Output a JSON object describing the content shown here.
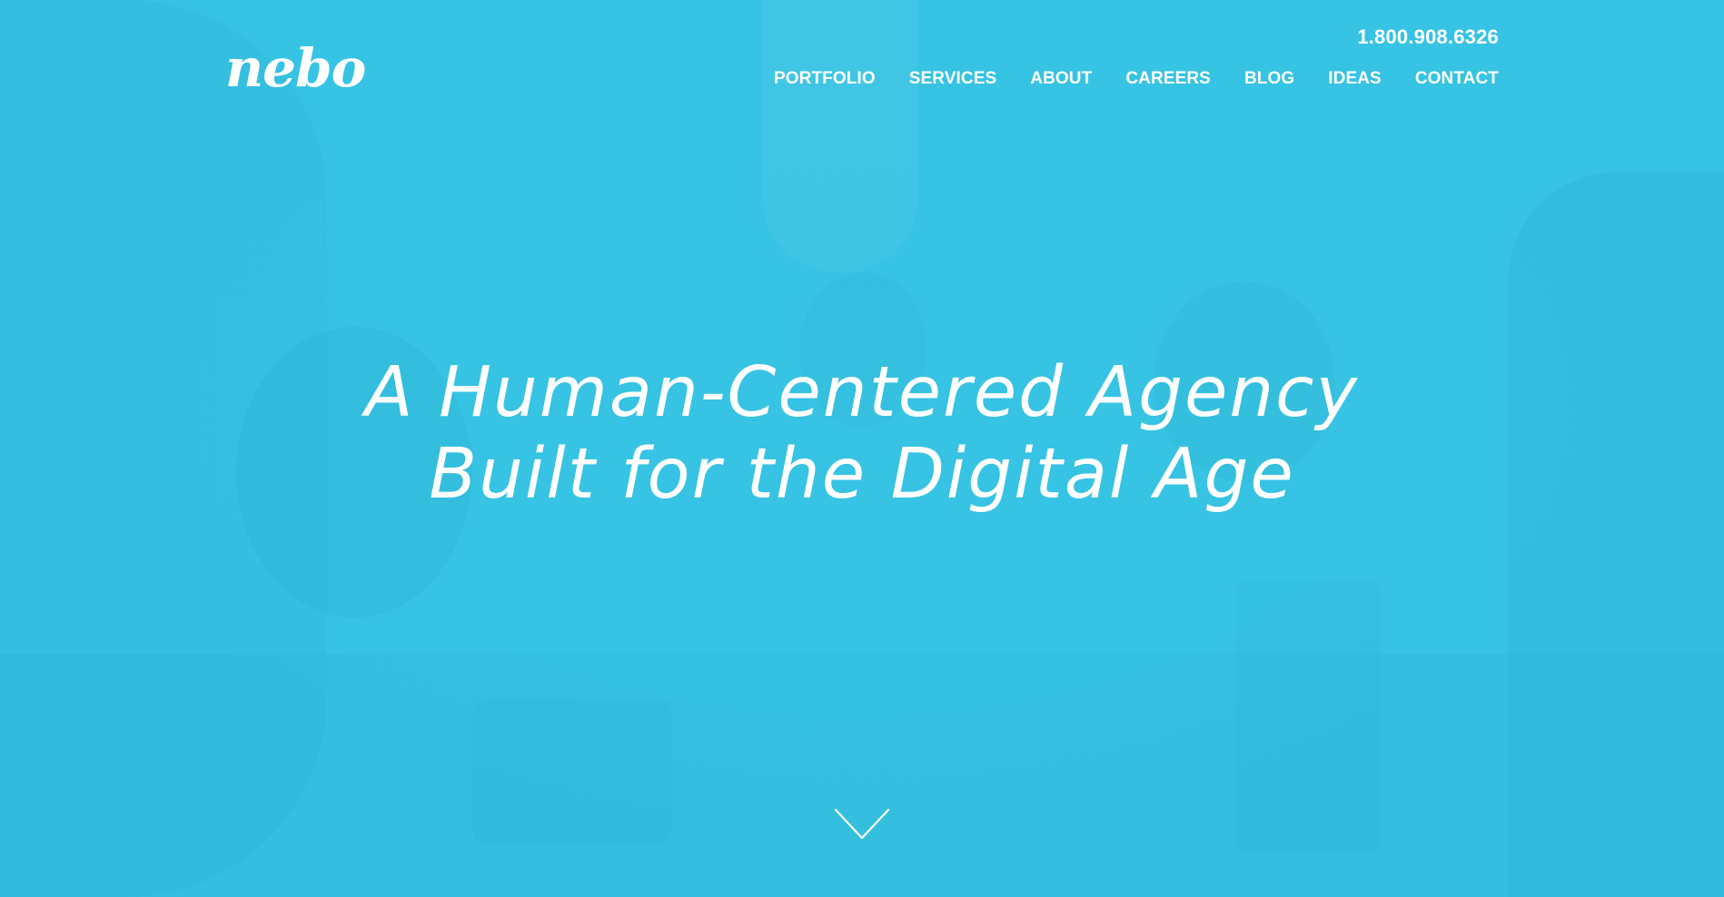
{
  "brand": {
    "logo_text": "nebo"
  },
  "header": {
    "phone": "1.800.908.6326"
  },
  "nav": {
    "items": [
      {
        "label": "PORTFOLIO"
      },
      {
        "label": "SERVICES"
      },
      {
        "label": "ABOUT"
      },
      {
        "label": "CAREERS"
      },
      {
        "label": "BLOG"
      },
      {
        "label": "IDEAS"
      },
      {
        "label": "CONTACT"
      }
    ]
  },
  "hero": {
    "headline_line1": "A Human-Centered Agency",
    "headline_line2": "Built for the Digital Age",
    "scroll_icon": "chevron-down-icon"
  },
  "colors": {
    "background": "#37c3e3",
    "text": "#ffffff"
  }
}
